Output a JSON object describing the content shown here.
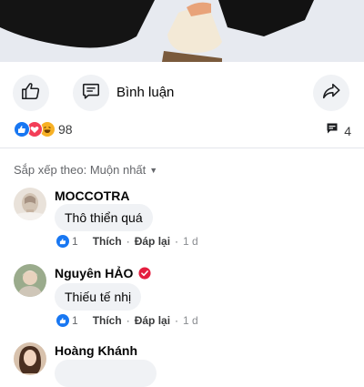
{
  "post": {
    "comment_label": "Bình luận",
    "reaction_count": "98",
    "comment_count": "4",
    "reactions": [
      "like",
      "love",
      "haha"
    ]
  },
  "sort": {
    "label": "Sắp xếp theo: Muộn nhất"
  },
  "comments": [
    {
      "author": "MOCCOTRA",
      "text": "Thô thiển quá",
      "like_count": "1",
      "like_label": "Thích",
      "reply_label": "Đáp lại",
      "time": "1 d",
      "verified": false
    },
    {
      "author": "Nguyên HẢO",
      "text": "Thiếu tế nhị",
      "like_count": "1",
      "like_label": "Thích",
      "reply_label": "Đáp lại",
      "time": "1 d",
      "verified": true
    },
    {
      "author": "Hoàng Khánh",
      "text": "",
      "verified": false
    }
  ],
  "colors": {
    "accent": "#1877f2",
    "love": "#f33e58",
    "haha": "#f7b125",
    "badge": "#e41e3f",
    "bubble": "#f0f2f5",
    "meta": "#65676b"
  }
}
